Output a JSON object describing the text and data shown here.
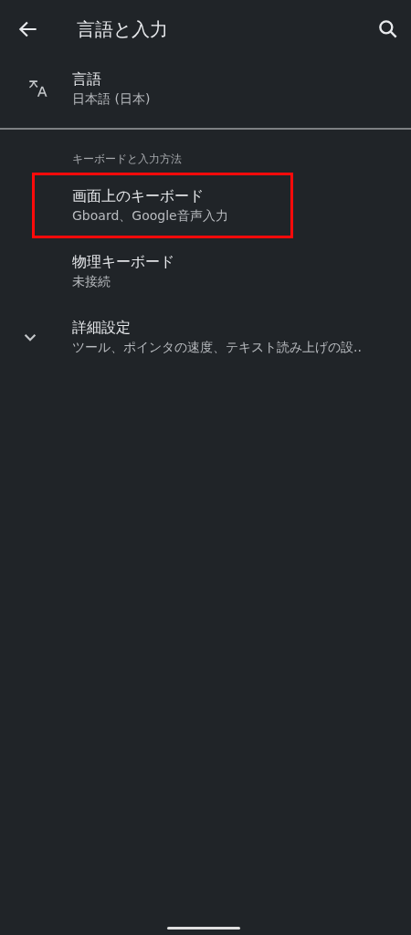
{
  "app_bar": {
    "title": "言語と入力"
  },
  "top_items": [
    {
      "kind": "language",
      "title": "言語",
      "summary": "日本語 (日本)"
    }
  ],
  "section": {
    "header": "キーボードと入力方法",
    "items": [
      {
        "kind": "plain",
        "title": "画面上のキーボード",
        "summary": "Gboard、Google音声入力",
        "highlighted": true
      },
      {
        "kind": "plain",
        "title": "物理キーボード",
        "summary": "未接続",
        "highlighted": false
      },
      {
        "kind": "expandable",
        "title": "詳細設定",
        "summary": "ツール、ポインタの速度、テキスト読み上げの設..",
        "highlighted": false,
        "expanded": false
      }
    ]
  }
}
